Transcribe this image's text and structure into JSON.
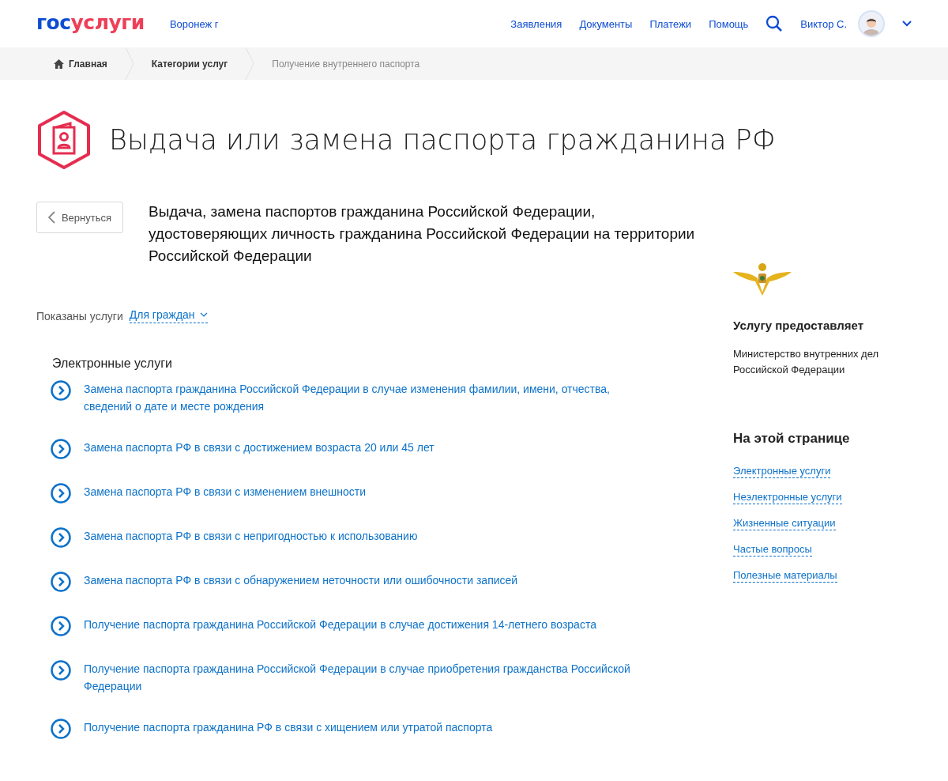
{
  "header": {
    "logo": {
      "part_1": "гос",
      "part_2": "услуги"
    },
    "region": "Воронеж г",
    "nav": [
      "Заявления",
      "Документы",
      "Платежи",
      "Помощь"
    ],
    "user_name": "Виктор С."
  },
  "breadcrumbs": [
    {
      "label": "Главная",
      "kind": "home"
    },
    {
      "label": "Категории услуг",
      "kind": "link"
    },
    {
      "label": "Получение внутреннего паспорта",
      "kind": "current"
    }
  ],
  "page_title": "Выдача или замена паспорта гражданина РФ",
  "back_button": "Вернуться",
  "service_title": "Выдача, замена паспортов гражданина Российской Федерации, удостоверяющих личность гражданина Российской Федерации на территории Российской Федерации",
  "filter": {
    "label": "Показаны услуги",
    "value": "Для граждан"
  },
  "section": {
    "title": "Электронные услуги",
    "services": [
      "Замена паспорта гражданина Российской Федерации в случае изменения фамилии, имени, отчества, сведений о дате и месте рождения",
      "Замена паспорта РФ в связи с достижением возраста 20 или 45 лет",
      "Замена паспорта РФ в связи с изменением внешности",
      "Замена паспорта РФ в связи с непригодностью к использованию",
      "Замена паспорта РФ в связи с обнаружением неточности или ошибочности записей",
      "Получение паспорта гражданина Российской Федерации в случае достижения 14-летнего возраста",
      "Получение паспорта гражданина Российской Федерации в случае приобретения гражданства Российской Федерации",
      "Получение паспорта гражданина РФ в связи с хищением или утратой паспорта"
    ]
  },
  "sidebar": {
    "provider_heading": "Услугу предоставляет",
    "provider_name": "Министерство внутренних дел Российской Федерации",
    "toc_heading": "На этой странице",
    "toc_links": [
      "Электронные услуги",
      "Неэлектронные услуги",
      "Жизненные ситуации",
      "Частые вопросы",
      "Полезные материалы"
    ]
  }
}
